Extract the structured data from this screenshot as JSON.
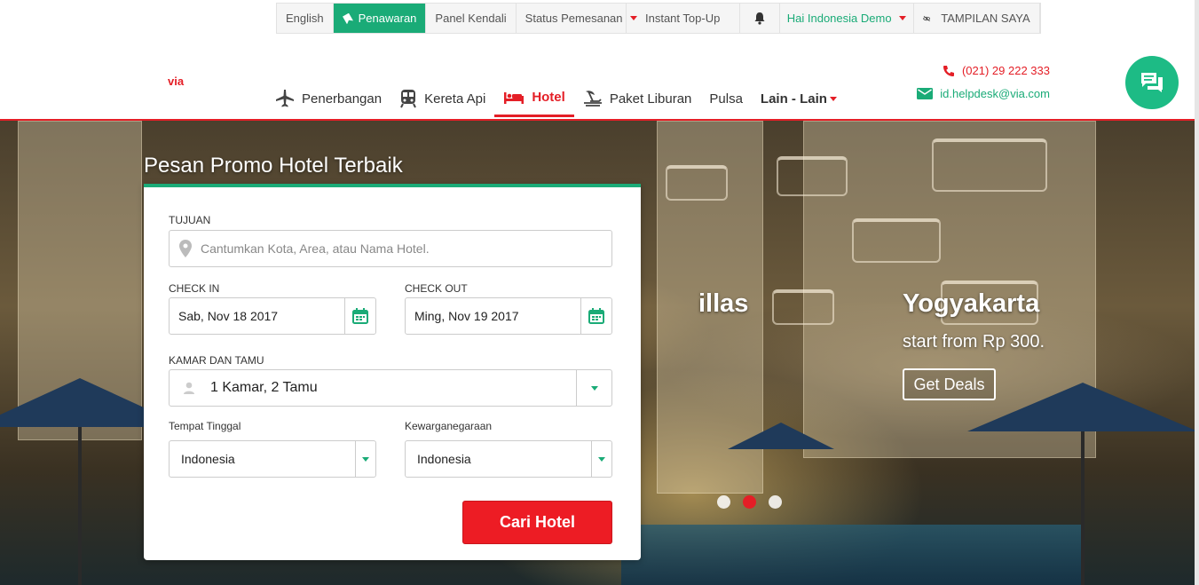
{
  "topbar": {
    "language": "English",
    "promo": "Penawaran",
    "dashboard": "Panel Kendali",
    "booking_status": "Status Pemesanan",
    "topup": "Instant Top-Up",
    "user": "Hai Indonesia Demo",
    "view": "TAMPILAN SAYA"
  },
  "brand": {
    "logo": "via"
  },
  "nav": {
    "flights": "Penerbangan",
    "train": "Kereta Api",
    "hotel": "Hotel",
    "holiday": "Paket Liburan",
    "pulsa": "Pulsa",
    "others": "Lain - Lain"
  },
  "contact": {
    "phone": "(021) 29 222 333",
    "email": "id.helpdesk@via.com"
  },
  "hero": {
    "prev_slide_fragment": "illas",
    "slide_title": "Yogyakarta",
    "slide_subtitle": "start from Rp 300.",
    "slide_button": "Get Deals",
    "active_dot": 2
  },
  "search": {
    "title": "Pesan Promo Hotel Terbaik",
    "destination_label": "TUJUAN",
    "destination_placeholder": "Cantumkan Kota, Area, atau Nama Hotel.",
    "checkin_label": "CHECK IN",
    "checkin_value": "Sab, Nov 18 2017",
    "checkout_label": "CHECK OUT",
    "checkout_value": "Ming, Nov 19 2017",
    "rooms_label": "KAMAR DAN TAMU",
    "rooms_value": "1 Kamar, 2 Tamu",
    "residence_label": "Tempat Tinggal",
    "residence_value": "Indonesia",
    "nationality_label": "Kewarganegaraan",
    "nationality_value": "Indonesia",
    "submit": "Cari Hotel"
  },
  "colors": {
    "brand_red": "#e41e26",
    "brand_green": "#1aab77"
  },
  "icons": [
    "bookmark-icon",
    "caret-down-icon",
    "bell-icon",
    "eye-off-icon",
    "airplane-icon",
    "train-icon",
    "bed-icon",
    "beach-icon",
    "phone-icon",
    "mail-icon",
    "chat-icon",
    "map-pin-icon",
    "calendar-icon",
    "person-icon"
  ]
}
